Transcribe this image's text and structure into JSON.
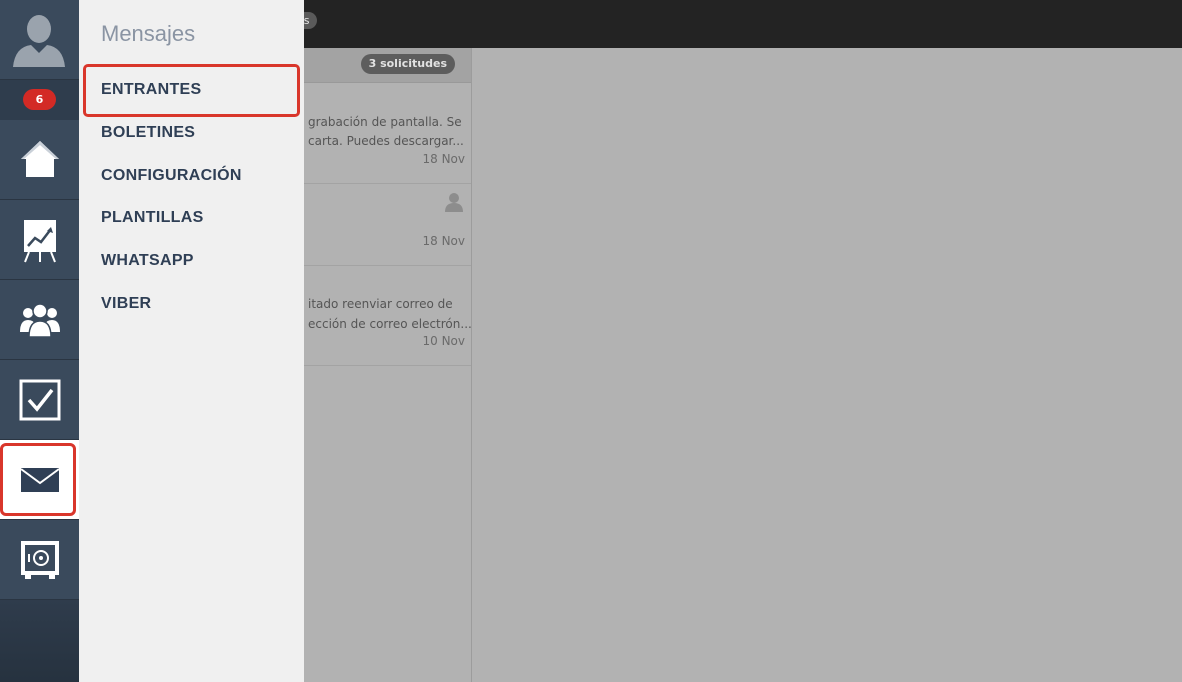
{
  "topbar": {
    "pill_text": "es"
  },
  "message_list": {
    "request_badge": "3 solicitudes",
    "items": [
      {
        "line1": "grabación de pantalla. Se",
        "line2": "carta. Puedes descargar...",
        "date": "18 Nov"
      },
      {
        "line1": "",
        "line2": "",
        "date": "18 Nov"
      },
      {
        "line1": "itado reenviar correo de",
        "line2": "ección de correo electrón...",
        "date": "10 Nov"
      }
    ]
  },
  "sidebar": {
    "notification_count": "6",
    "icons": [
      "user-avatar-icon",
      "home-icon",
      "chart-presentation-icon",
      "group-icon",
      "checkbox-icon",
      "envelope-icon",
      "safe-icon"
    ]
  },
  "submenu": {
    "title": "Mensajes",
    "items": [
      {
        "label": "ENTRANTES"
      },
      {
        "label": "BOLETINES"
      },
      {
        "label": "CONFIGURACIÓN"
      },
      {
        "label": "PLANTILLAS"
      },
      {
        "label": "WHATSAPP"
      },
      {
        "label": "VIBER"
      }
    ]
  },
  "colors": {
    "sidebar": "#3a4a5c",
    "submenu_bg": "#f0f0f0",
    "highlight": "#d9362b",
    "badge": "#d32a25",
    "submenu_text": "#2f3f55"
  }
}
